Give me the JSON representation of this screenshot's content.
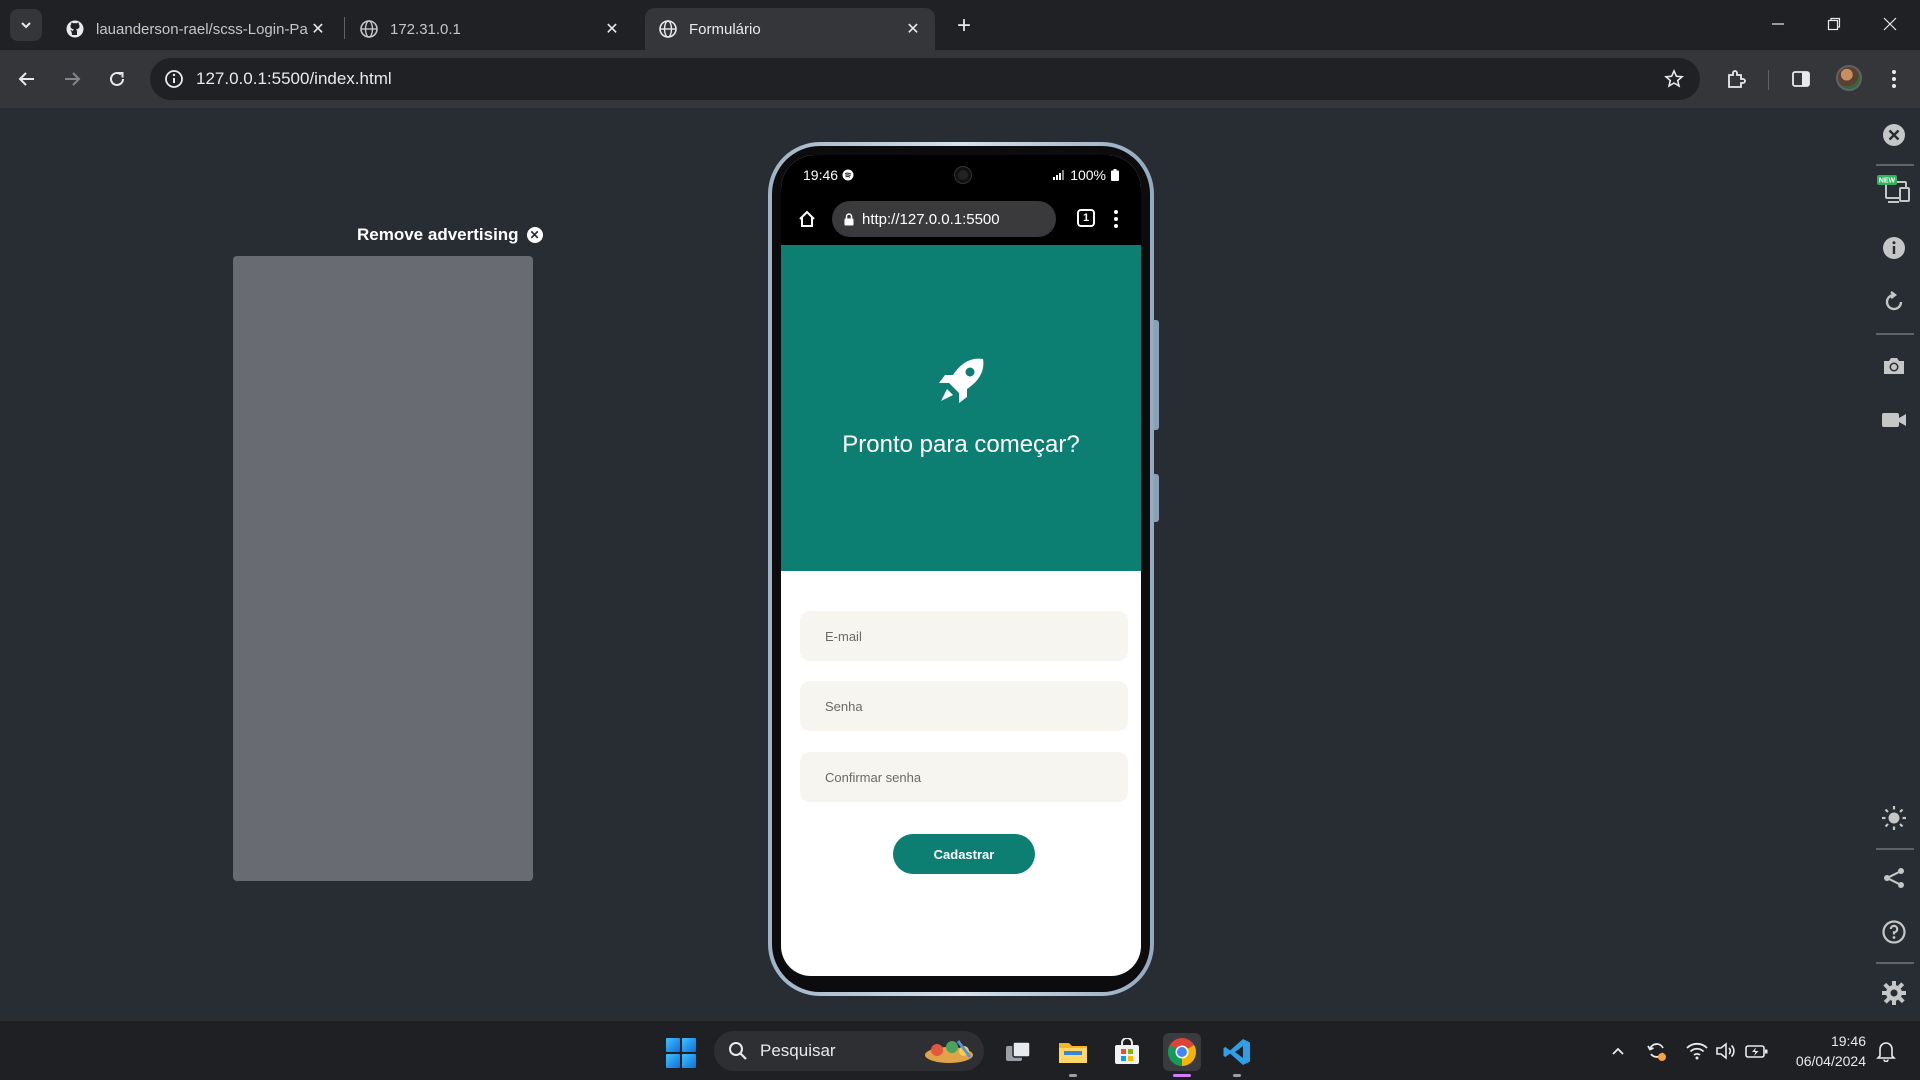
{
  "browser": {
    "tabs": [
      {
        "title": "lauanderson-rael/scss-Login-Pa",
        "favicon": "github-icon",
        "active": false
      },
      {
        "title": "172.31.0.1",
        "favicon": "globe-icon",
        "active": false
      },
      {
        "title": "Formulário",
        "favicon": "globe-icon",
        "active": true
      }
    ],
    "address": "127.0.0.1:5500/index.html"
  },
  "page": {
    "ad": {
      "remove_label": "Remove advertising"
    },
    "phone": {
      "status": {
        "time": "19:46",
        "battery": "100%"
      },
      "mobile_url": "http://127.0.0.1:5500",
      "tab_count": "1",
      "hero_title": "Pronto para começar?",
      "form": {
        "email_placeholder": "E-mail",
        "password_placeholder": "Senha",
        "confirm_placeholder": "Confirmar senha",
        "submit_label": "Cadastrar"
      }
    },
    "rail": {
      "new_badge": "NEW"
    }
  },
  "taskbar": {
    "search_label": "Pesquisar",
    "time": "19:46",
    "date": "06/04/2024"
  },
  "colors": {
    "accent": "#0d7f72",
    "field_bg": "#f6f5ef",
    "page_bg": "#282c33"
  }
}
